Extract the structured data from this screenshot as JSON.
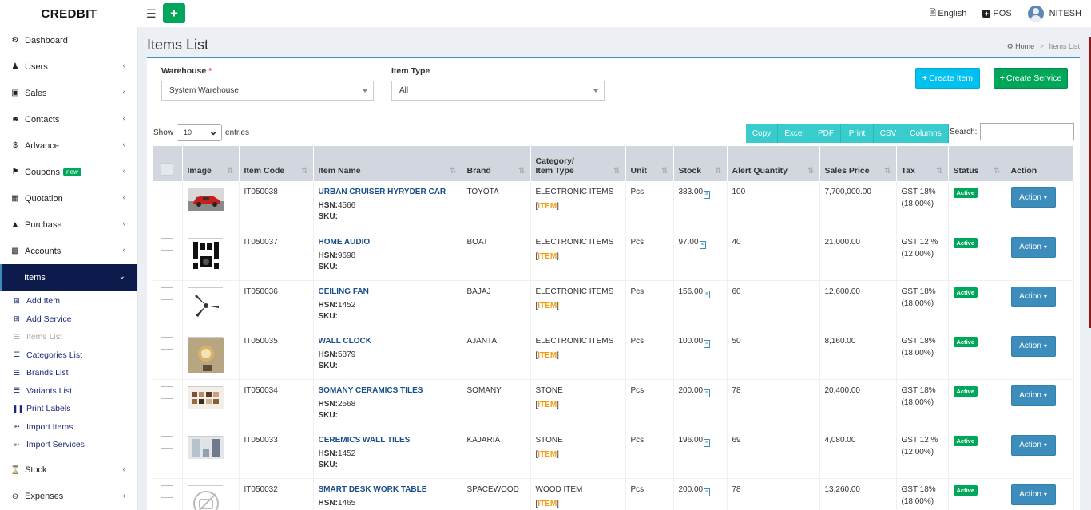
{
  "app": {
    "brand": "CREDBIT"
  },
  "topbar": {
    "language": "English",
    "pos": "POS",
    "user": "NITESH"
  },
  "sidebar": {
    "items": [
      {
        "label": "Dashboard",
        "icon": "dashboard-icon",
        "chevron": false
      },
      {
        "label": "Users",
        "icon": "user-plus-icon",
        "chevron": true
      },
      {
        "label": "Sales",
        "icon": "cart-icon",
        "chevron": true
      },
      {
        "label": "Contacts",
        "icon": "users-icon",
        "chevron": true
      },
      {
        "label": "Advance",
        "icon": "dollar-icon",
        "chevron": true
      },
      {
        "label": "Coupons",
        "icon": "tags-icon",
        "chevron": true,
        "badge": "new"
      },
      {
        "label": "Quotation",
        "icon": "calendar-icon",
        "chevron": true
      },
      {
        "label": "Purchase",
        "icon": "cube-icon",
        "chevron": true
      },
      {
        "label": "Accounts",
        "icon": "grid-icon",
        "chevron": true
      },
      {
        "label": "Items",
        "icon": "",
        "chevron": true,
        "active": true
      }
    ],
    "sub_items": [
      {
        "label": "Add Item",
        "icon": "plus-square-icon"
      },
      {
        "label": "Add Service",
        "icon": "plus-square-icon"
      },
      {
        "label": "Items List",
        "icon": "list-icon",
        "current": true
      },
      {
        "label": "Categories List",
        "icon": "list-icon"
      },
      {
        "label": "Brands List",
        "icon": "list-icon"
      },
      {
        "label": "Variants List",
        "icon": "list-icon"
      },
      {
        "label": "Print Labels",
        "icon": "barcode-icon"
      },
      {
        "label": "Import Items",
        "icon": "arrow-circle-icon"
      },
      {
        "label": "Import Services",
        "icon": "arrow-circle-icon"
      }
    ],
    "bottom_items": [
      {
        "label": "Stock",
        "icon": "hourglass-icon",
        "chevron": true
      },
      {
        "label": "Expenses",
        "icon": "minus-circle-icon",
        "chevron": true
      }
    ]
  },
  "page": {
    "title": "Items List",
    "breadcrumb": {
      "home": "Home",
      "current": "Items List"
    }
  },
  "filters": {
    "warehouse_label": "Warehouse",
    "warehouse_required": "*",
    "warehouse_value": "System Warehouse",
    "item_type_label": "Item Type",
    "item_type_value": "All"
  },
  "actions": {
    "create_item": "Create Item",
    "create_service": "Create Service"
  },
  "datatable": {
    "show": "Show",
    "length": "10",
    "entries": "entries",
    "buttons": [
      "Copy",
      "Excel",
      "PDF",
      "Print",
      "CSV",
      "Columns"
    ],
    "search_label": "Search:"
  },
  "table": {
    "headers": {
      "image": "Image",
      "code": "Item Code",
      "name": "Item Name",
      "brand": "Brand",
      "category_top": "Category/",
      "category_bottom": "Item Type",
      "unit": "Unit",
      "stock": "Stock",
      "alert": "Alert Quantity",
      "price": "Sales Price",
      "tax": "Tax",
      "status": "Status",
      "action": "Action"
    },
    "hsn_label": "HSN:",
    "sku_label": "SKU:",
    "action_label": "Action",
    "rows": [
      {
        "code": "IT050038",
        "name": "URBAN CRUISER HYRYDER CAR",
        "hsn": "4566",
        "brand": "TOYOTA",
        "category": "ELECTRONIC ITEMS",
        "item_type": "ITEM",
        "unit": "Pcs",
        "stock": "383.00",
        "alert": "100",
        "price": "7,700,000.00",
        "tax": "GST 18%",
        "tax_rate": "(18.00%)",
        "status": "Active",
        "img": "car"
      },
      {
        "code": "IT050037",
        "name": "HOME AUDIO",
        "hsn": "9698",
        "brand": "BOAT",
        "category": "ELECTRONIC ITEMS",
        "item_type": "ITEM",
        "unit": "Pcs",
        "stock": "97.00",
        "alert": "40",
        "price": "21,000.00",
        "tax": "GST 12 %",
        "tax_rate": "(12.00%)",
        "status": "Active",
        "img": "audio"
      },
      {
        "code": "IT050036",
        "name": "CEILING FAN",
        "hsn": "1452",
        "brand": "BAJAJ",
        "category": "ELECTRONIC ITEMS",
        "item_type": "ITEM",
        "unit": "Pcs",
        "stock": "156.00",
        "alert": "60",
        "price": "12,600.00",
        "tax": "GST 18%",
        "tax_rate": "(18.00%)",
        "status": "Active",
        "img": "fan"
      },
      {
        "code": "IT050035",
        "name": "WALL CLOCK",
        "hsn": "5879",
        "brand": "AJANTA",
        "category": "ELECTRONIC ITEMS",
        "item_type": "ITEM",
        "unit": "Pcs",
        "stock": "100.00",
        "alert": "50",
        "price": "8,160.00",
        "tax": "GST 18%",
        "tax_rate": "(18.00%)",
        "status": "Active",
        "img": "clock"
      },
      {
        "code": "IT050034",
        "name": "SOMANY CERAMICS TILES",
        "hsn": "2568",
        "brand": "SOMANY",
        "category": "STONE",
        "item_type": "ITEM",
        "unit": "Pcs",
        "stock": "200.00",
        "alert": "78",
        "price": "20,400.00",
        "tax": "GST 18%",
        "tax_rate": "(18.00%)",
        "status": "Active",
        "img": "tiles"
      },
      {
        "code": "IT050033",
        "name": "CEREMICS WALL TILES",
        "hsn": "1452",
        "brand": "KAJARIA",
        "category": "STONE",
        "item_type": "ITEM",
        "unit": "Pcs",
        "stock": "196.00",
        "alert": "69",
        "price": "4,080.00",
        "tax": "GST 12 %",
        "tax_rate": "(12.00%)",
        "status": "Active",
        "img": "walltiles"
      },
      {
        "code": "IT050032",
        "name": "SMART DESK WORK TABLE",
        "hsn": "1465",
        "brand": "SPACEWOOD",
        "category": "WOOD ITEM",
        "item_type": "ITEM",
        "unit": "Pcs",
        "stock": "200.00",
        "alert": "78",
        "price": "13,260.00",
        "tax": "GST 18%",
        "tax_rate": "(18.00%)",
        "status": "Active",
        "img": "noimage"
      }
    ]
  },
  "colors": {
    "primary": "#3c8dbc",
    "success": "#00a65a",
    "info": "#00c0ef",
    "teal": "#39cccc",
    "sidebar_active": "#0d1b4c"
  }
}
